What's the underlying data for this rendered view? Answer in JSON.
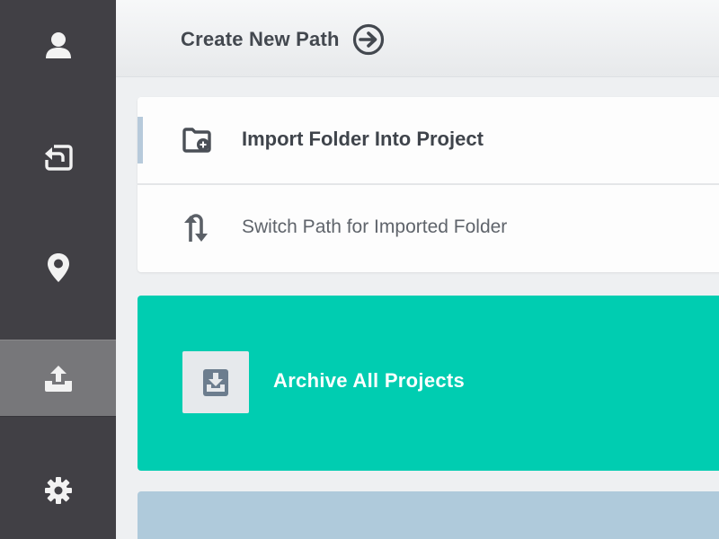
{
  "sidebar": {
    "items": [
      {
        "icon": "user-icon",
        "active": false
      },
      {
        "icon": "return-icon",
        "active": false
      },
      {
        "icon": "location-pin-icon",
        "active": false
      },
      {
        "icon": "upload-tray-icon",
        "active": true
      },
      {
        "icon": "gear-icon",
        "active": false
      }
    ]
  },
  "header": {
    "create_path_label": "Create New Path",
    "create_path_icon": "arrow-circle-right-icon"
  },
  "menu": {
    "items": [
      {
        "label": "Import Folder Into Project",
        "icon": "folder-add-icon"
      },
      {
        "label": "Switch Path for Imported Folder",
        "icon": "switch-arrows-icon"
      }
    ]
  },
  "archive": {
    "label": "Archive All Projects",
    "icon": "archive-download-icon"
  },
  "colors": {
    "sidebar_bg": "#414045",
    "sidebar_active": "#77777a",
    "accent_teal": "#00cdb1",
    "bottom_card": "#afcadb",
    "text_dark": "#42464d"
  }
}
